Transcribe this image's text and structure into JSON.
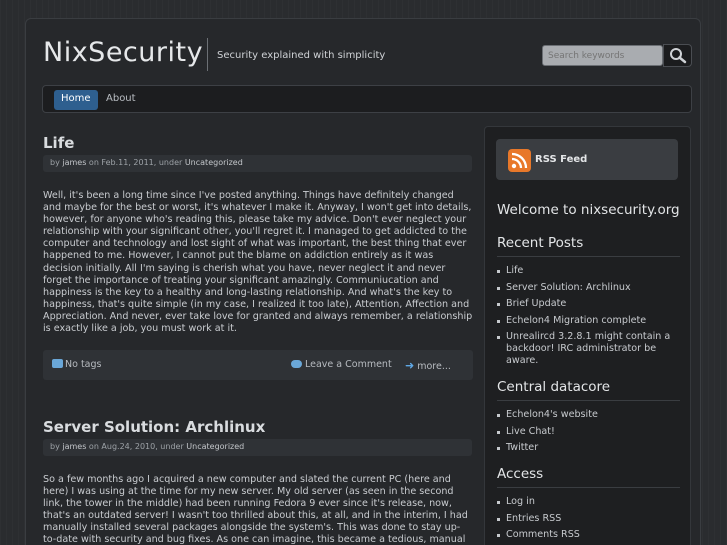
{
  "header": {
    "site_title": "NixSecurity",
    "tagline": "Security explained with simplicity",
    "search_placeholder": "Search keywords"
  },
  "nav": {
    "items": [
      {
        "label": "Home",
        "active": true
      },
      {
        "label": "About",
        "active": false
      }
    ]
  },
  "posts": [
    {
      "title": "Life",
      "meta_by": "by",
      "author": "james",
      "meta_on": "on Feb.11, 2011, under",
      "category": "Uncategorized",
      "body": "Well, it's been a long time since I've posted anything. Things have definitely changed and maybe for the best or worst, it's whatever I make it. Anyway, I won't get into details, however, for anyone who's reading this, please take my advice. Don't ever neglect your relationship with your significant other, you'll regret it. I managed to get addicted to the computer and technology and lost sight of what was important, the best thing that ever happened to me. However, I cannot put the blame on addiction entirely as it was decision initially. All I'm saying is cherish what you have, never neglect it and never forget the importance of treating your significant amazingly. Communiucation and happiness is the key to a healthy and long-lasting relationship. And what's the key to happiness, that's quite simple (in my case, I realized it too late), Attention, Affection and Appreciation. And never, ever take love for granted and always remember, a relationship is exactly like a job, you must work at it.",
      "tags": "No tags",
      "comment": "Leave a Comment",
      "more": "more..."
    },
    {
      "title": "Server Solution: Archlinux",
      "meta_by": "by",
      "author": "james",
      "meta_on": "on Aug.24, 2010, under",
      "category": "Uncategorized",
      "body": "So a few months ago I acquired a new computer and slated the current PC (here and here) I was using at the time for my new server. My old server (as seen in the second link, the tower in the middle) had been running Fedora 9 ever since it's release, now, that's an outdated server! I wasn't too thrilled about this, at all, and in the interim, I had manually installed several packages alongside the system's. This was done to stay up-to-date with security and bug fixes. As one can imagine, this became a tedious, manual process."
    }
  ],
  "sidebar": {
    "rss_label": "RSS Feed",
    "welcome": "Welcome to nixsecurity.org",
    "recent_heading": "Recent Posts",
    "recent": [
      "Life",
      "Server Solution: Archlinux",
      "Brief Update",
      "Echelon4 Migration complete",
      "Unrealircd 3.2.8.1 might contain a backdoor! IRC administrator be aware."
    ],
    "datacore_heading": "Central datacore",
    "datacore": [
      "Echelon4's website",
      "Live Chat!",
      "Twitter"
    ],
    "access_heading": "Access",
    "access": [
      "Log in",
      "Entries RSS",
      "Comments RSS"
    ]
  },
  "colors": {
    "background": "#2a2c2f",
    "nav_active": "#2e5f8f",
    "rss_orange": "#e8782a",
    "link_blue": "#6aa7d8"
  }
}
